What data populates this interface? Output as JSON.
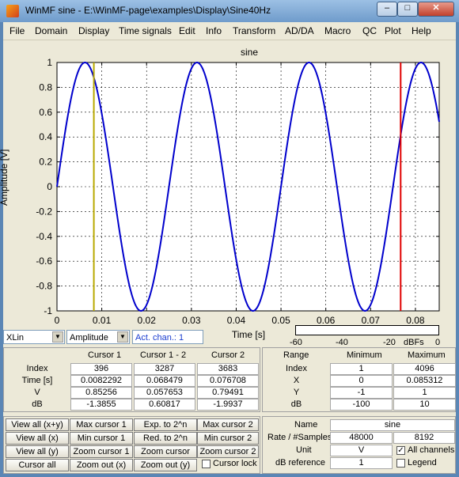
{
  "window": {
    "title": "WinMF    sine - E:\\WinMF-page\\examples\\Display\\Sine40Hz",
    "minimize": "–",
    "maximize": "□",
    "close": "✕"
  },
  "menu": [
    "File",
    "Domain",
    "Display",
    "Time signals",
    "Edit",
    "Info",
    "Transform",
    "AD/DA",
    "Macro",
    "QC",
    "Plot",
    "Help"
  ],
  "plot": {
    "title": "sine",
    "ylabel": "Amplitude [V]",
    "xlabel": "Time [s]"
  },
  "chart_data": {
    "type": "line",
    "title": "sine",
    "xlabel": "Time [s]",
    "ylabel": "Amplitude [V]",
    "xlim": [
      0,
      0.085312
    ],
    "ylim": [
      -1,
      1
    ],
    "grid": true,
    "x_ticks": [
      "0",
      "0.01",
      "0.02",
      "0.03",
      "0.04",
      "0.05",
      "0.06",
      "0.07",
      "0.08"
    ],
    "y_ticks": [
      "1",
      "0.8",
      "0.6",
      "0.4",
      "0.2",
      "0",
      "-0.2",
      "-0.4",
      "-0.6",
      "-0.8",
      "-1"
    ],
    "series": [
      {
        "frequency_hz": 40,
        "amplitude": 1,
        "color": "#0000cc"
      }
    ],
    "cursors": [
      {
        "x": 0.0082292,
        "color": "#b8a800"
      },
      {
        "x": 0.076708,
        "color": "#e00000"
      }
    ]
  },
  "controls": {
    "xscale": "XLin",
    "yquantity": "Amplitude",
    "act_chan": "Act. chan.: 1"
  },
  "dbfs": {
    "ticks": [
      "-60",
      "-40",
      "-20",
      "dBFs",
      "0"
    ]
  },
  "cursor_table": {
    "headers": [
      "Cursor 1",
      "Cursor 1 - 2",
      "Cursor 2"
    ],
    "rows": [
      {
        "label": "Index",
        "values": [
          "396",
          "3287",
          "3683"
        ]
      },
      {
        "label": "Time [s]",
        "values": [
          "0.0082292",
          "0.068479",
          "0.076708"
        ]
      },
      {
        "label": "V",
        "values": [
          "0.85256",
          "0.057653",
          "0.79491"
        ]
      },
      {
        "label": "dB",
        "values": [
          "-1.3855",
          "0.60817",
          "-1.9937"
        ]
      }
    ]
  },
  "range_table": {
    "headers": [
      "Range",
      "Minimum",
      "Maximum"
    ],
    "rows": [
      {
        "label": "Index",
        "values": [
          "1",
          "4096"
        ]
      },
      {
        "label": "X",
        "values": [
          "0",
          "0.085312"
        ]
      },
      {
        "label": "Y",
        "values": [
          "-1",
          "1"
        ]
      },
      {
        "label": "dB",
        "values": [
          "-100",
          "10"
        ]
      }
    ]
  },
  "buttons": [
    [
      "View all (x+y)",
      "Max cursor 1",
      "Exp. to 2^n",
      "Max cursor 2"
    ],
    [
      "View all (x)",
      "Min cursor 1",
      "Red. to 2^n",
      "Min cursor 2"
    ],
    [
      "View all (y)",
      "Zoom cursor 1",
      "Zoom cursor",
      "Zoom cursor 2"
    ],
    [
      "Cursor all",
      "Zoom out (x)",
      "Zoom out (y)"
    ]
  ],
  "cursor_lock": "Cursor lock",
  "info": {
    "name_label": "Name",
    "name": "sine",
    "rate_label": "Rate / #Samples",
    "rate": "48000",
    "samples": "8192",
    "unit_label": "Unit",
    "unit": "V",
    "all_channels": "All channels",
    "dbref_label": "dB reference",
    "dbref": "1",
    "legend": "Legend"
  }
}
